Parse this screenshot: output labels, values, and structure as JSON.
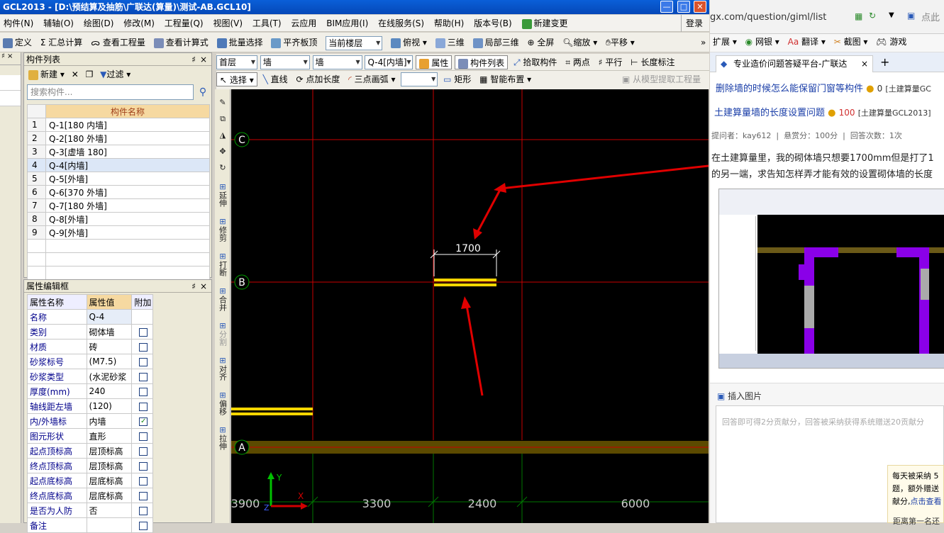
{
  "window": {
    "title": "GCL2013 - [D:\\预结算及抽筋\\广联达(算量)\\测试-AB.GCL10]"
  },
  "menu": [
    "构件(N)",
    "辅轴(O)",
    "绘图(D)",
    "修改(M)",
    "工程量(Q)",
    "视图(V)",
    "工具(T)",
    "云应用",
    "BIM应用(I)",
    "在线服务(S)",
    "帮助(H)",
    "版本号(B)",
    "新建变更"
  ],
  "login": "登录",
  "toolbar1": {
    "define": "定义",
    "sum": "汇总计算",
    "view_project": "查看工程量",
    "view_formula": "查看计算式",
    "batch_select": "批量选择",
    "flat_top": "平齐板顶",
    "floor_combo": "当前楼层",
    "overview": "俯视",
    "three_d": "三维",
    "local_3d": "局部三维",
    "fullscreen": "全屏",
    "zoom": "缩放",
    "pan": "平移"
  },
  "component_panel": {
    "title": "构件列表",
    "new": "新建",
    "filter": "过滤",
    "search_placeholder": "搜索构件...",
    "header": "构件名称",
    "rows": [
      {
        "n": "1",
        "name": "Q-1[180 内墙]"
      },
      {
        "n": "2",
        "name": "Q-2[180 外墙]"
      },
      {
        "n": "3",
        "name": "Q-3[虚墙 180]"
      },
      {
        "n": "4",
        "name": "Q-4[内墙]"
      },
      {
        "n": "5",
        "name": "Q-5[外墙]"
      },
      {
        "n": "6",
        "name": "Q-6[370 外墙]"
      },
      {
        "n": "7",
        "name": "Q-7[180 外墙]"
      },
      {
        "n": "8",
        "name": "Q-8[外墙]"
      },
      {
        "n": "9",
        "name": "Q-9[外墙]"
      }
    ],
    "selected_index": 3
  },
  "property_panel": {
    "title": "属性编辑框",
    "headers": [
      "属性名称",
      "属性值",
      "附加"
    ],
    "rows": [
      {
        "name": "名称",
        "value": "Q-4",
        "check": null
      },
      {
        "name": "类别",
        "value": "砌体墙",
        "check": false
      },
      {
        "name": "材质",
        "value": "砖",
        "check": false
      },
      {
        "name": "砂浆标号",
        "value": "(M7.5)",
        "check": false
      },
      {
        "name": "砂浆类型",
        "value": "(水泥砂浆",
        "check": false
      },
      {
        "name": "厚度(mm)",
        "value": "240",
        "check": false
      },
      {
        "name": "轴线距左墙",
        "value": "(120)",
        "check": false
      },
      {
        "name": "内/外墙标",
        "value": "内墙",
        "check": true
      },
      {
        "name": "图元形状",
        "value": "直形",
        "check": false
      },
      {
        "name": "起点顶标高",
        "value": "层顶标高",
        "check": false
      },
      {
        "name": "终点顶标高",
        "value": "层顶标高",
        "check": false
      },
      {
        "name": "起点底标高",
        "value": "层底标高",
        "check": false
      },
      {
        "name": "终点底标高",
        "value": "层底标高",
        "check": false
      },
      {
        "name": "是否为人防",
        "value": "否",
        "check": false
      },
      {
        "name": "备注",
        "value": "",
        "check": false
      }
    ]
  },
  "draw_toolbar": {
    "floor": "首层",
    "type1": "墙",
    "type2": "墙",
    "component": "Q-4[内墙]",
    "property": "属性",
    "component_list": "构件列表",
    "pick": "拾取构件",
    "two_point": "两点",
    "parallel": "平行",
    "length_dim": "长度标注",
    "select": "选择",
    "line": "直线",
    "point_length": "点加长度",
    "arc3": "三点画弧",
    "rect": "矩形",
    "smart_layout": "智能布置",
    "extract": "从模型提取工程量"
  },
  "vertical_tools": [
    "延伸",
    "修剪",
    "打断",
    "合并",
    "分割",
    "对齐",
    "偏移",
    "拉伸"
  ],
  "canvas": {
    "axes": [
      "C",
      "B",
      "A"
    ],
    "dimension_label": "1700",
    "bottom_dims": [
      "3900",
      "3300",
      "2400",
      "6000"
    ],
    "x_axis": "X",
    "y_axis": "Y",
    "z_axis": "Z",
    "colors": {
      "grid": "#c80000",
      "wall": "#ffd600",
      "bottom_grid": "#007800",
      "arrow": "#e00000"
    }
  },
  "browser": {
    "url": "gx.com/question/giml/list",
    "search_hint": "点此",
    "toolbar": [
      "扩展",
      "网银",
      "翻译",
      "截图",
      "游戏"
    ],
    "tab": "专业造价问题答疑平台-广联达",
    "q1_title": "删除墙的时候怎么能保留门窗等构件",
    "q1_score": "0",
    "q1_tag": "[土建算量GC",
    "q2_title": "土建算量墙的长度设置问题",
    "q2_score": "100",
    "q2_tag": "[土建算量GCL2013]",
    "asker": "提问者：kay612",
    "reward": "悬赏分：100分",
    "answers": "回答次数：1次",
    "body1": "在土建算量里，我的砌体墙只想要1700mm但是打了1",
    "body2": "的另一端，求告知怎样弄才能有效的设置砌体墙的长度",
    "insert_image": "插入图片",
    "answer_hint": "回答即可得2分贡献分，回答被采纳获得系统赠送20贡献分",
    "notice1": "每天被采纳 5",
    "notice2": "题，额外赠送",
    "notice3": "献分,",
    "notice_link": "点击查看",
    "footer": "距离第一名还"
  }
}
